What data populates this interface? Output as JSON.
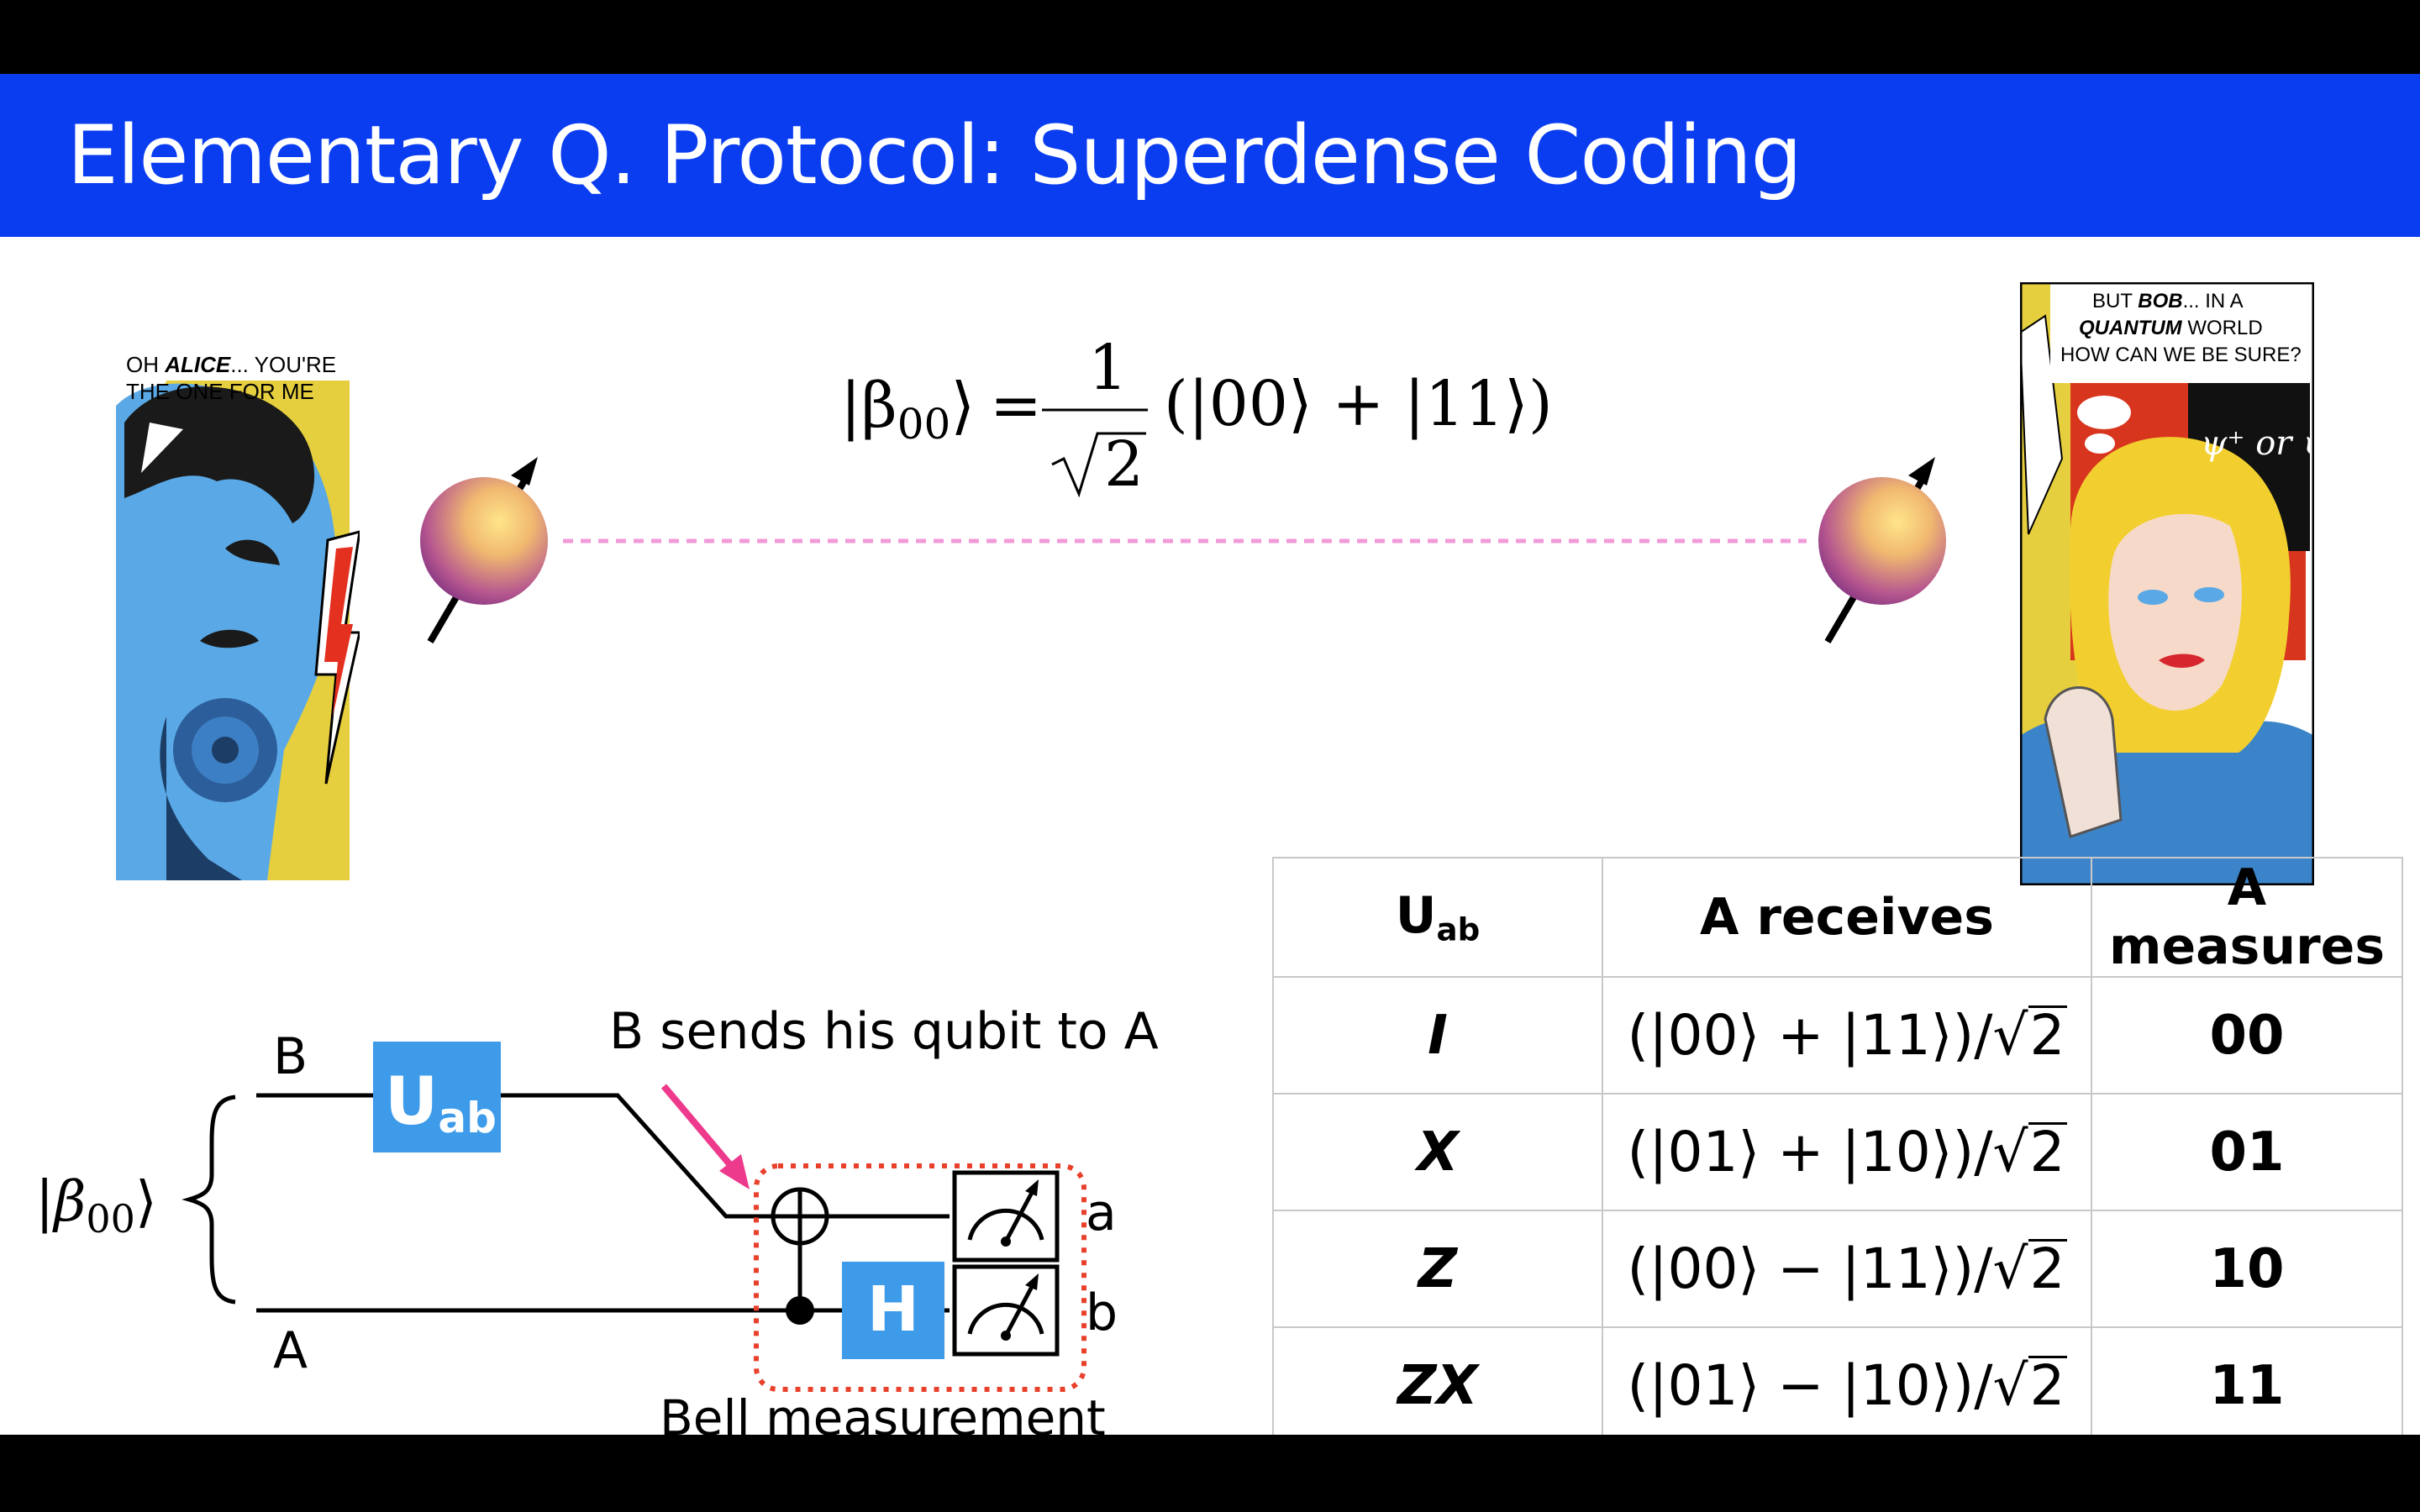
{
  "title": "Elementary Q. Protocol: Superdense Coding",
  "comics": {
    "alice": {
      "speech_line1_pre": "OH ",
      "speech_name": "ALICE",
      "speech_line1_post": "... YOU'RE",
      "speech_line2": "THE ONE FOR ME"
    },
    "bob": {
      "speech_line1_pre": "BUT ",
      "speech_name": "BOB",
      "speech_line1_post": "... IN A",
      "speech_line2_em": "QUANTUM",
      "speech_line2_post": " WORLD",
      "speech_line3": "HOW CAN WE BE SURE?",
      "thought": "ψ⁺ or ψ⁻ ?"
    }
  },
  "equation": {
    "lhs": "|β",
    "lhs_sub": "00",
    "lhs_close": "⟩",
    "equals": "=",
    "numerator": "1",
    "denominator": "2",
    "rhs": "(|00⟩ + |11⟩)"
  },
  "circuit": {
    "input_state": "|β",
    "input_sub": "00",
    "input_close": "⟩",
    "wire_b_label": "B",
    "wire_a_label": "A",
    "gate_u": "U",
    "gate_u_sub": "ab",
    "gate_h": "H",
    "annotation": "B sends his qubit to A",
    "box_label": "Bell measurement",
    "out_a": "a",
    "out_b": "b"
  },
  "table": {
    "headers": {
      "op_main": "U",
      "op_sub": "ab",
      "receives": "A receives",
      "measures": "A measures"
    },
    "rows": [
      {
        "op": "I",
        "state": "(|00⟩ + |11⟩)/",
        "root": "2",
        "bits": "00"
      },
      {
        "op": "X",
        "state": "(|01⟩ + |10⟩)/",
        "root": "2",
        "bits": "01"
      },
      {
        "op": "Z",
        "state": "(|00⟩ − |11⟩)/",
        "root": "2",
        "bits": "10"
      },
      {
        "op": "ZX",
        "state": "(|01⟩ − |10⟩)/",
        "root": "2",
        "bits": "11"
      }
    ]
  },
  "colors": {
    "title_bar": "#0a3df0",
    "gate": "#3d9be9",
    "entanglement_line": "#f29ad8",
    "annotation_arrow": "#ee3a8c",
    "measurement_box": "#e8402a"
  }
}
